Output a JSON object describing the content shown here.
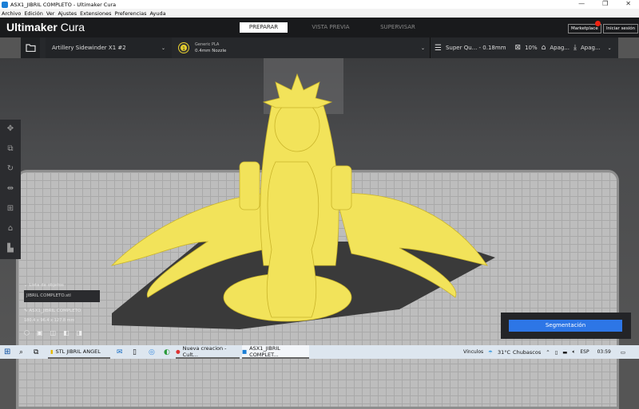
{
  "window": {
    "title": "ASX1_JIBRIL COMPLETO - Ultimaker Cura",
    "minimize": "—",
    "maximize": "❐",
    "close": "✕"
  },
  "menu": [
    "Archivo",
    "Edición",
    "Ver",
    "Ajustes",
    "Extensiones",
    "Preferencias",
    "Ayuda"
  ],
  "header": {
    "brand_bold": "Ultimaker",
    "brand_light": "Cura",
    "stages": [
      "PREPARAR",
      "VISTA PREVIA",
      "SUPERVISAR"
    ],
    "active_stage": "PREPARAR",
    "marketplace": "Marketplace",
    "marketplace_badge": "1",
    "login": "Iniciar sesión"
  },
  "toolbar": {
    "printer": "Artillery Sidewinder X1 #2",
    "material": "Generic PLA",
    "nozzle": "0.4mm Nozzle",
    "extruder_number": "1",
    "profile": "Super Qu... - 0.18mm",
    "infill": "10%",
    "support": "Apag...",
    "adhesion": "Apag..."
  },
  "objects": {
    "list_label": "Lista de objetos",
    "file": "JIBRIL COMPLETO.stl",
    "name": "ASX1_JIBRIL COMPLETO",
    "dimensions": "180.4 x 96.4 x 127.8 mm"
  },
  "slice": {
    "button": "Segmentación"
  },
  "model_color": "#f2e35a",
  "taskbar": {
    "items": [
      "STL JIBRIL ANGEL",
      "Nueva creacion - Cult...",
      "ASX1_JIBRIL COMPLET..."
    ],
    "links": "Vínculos",
    "temperature": "31°C",
    "weather": "Chubascos",
    "language": "ESP",
    "time": "03:59"
  }
}
